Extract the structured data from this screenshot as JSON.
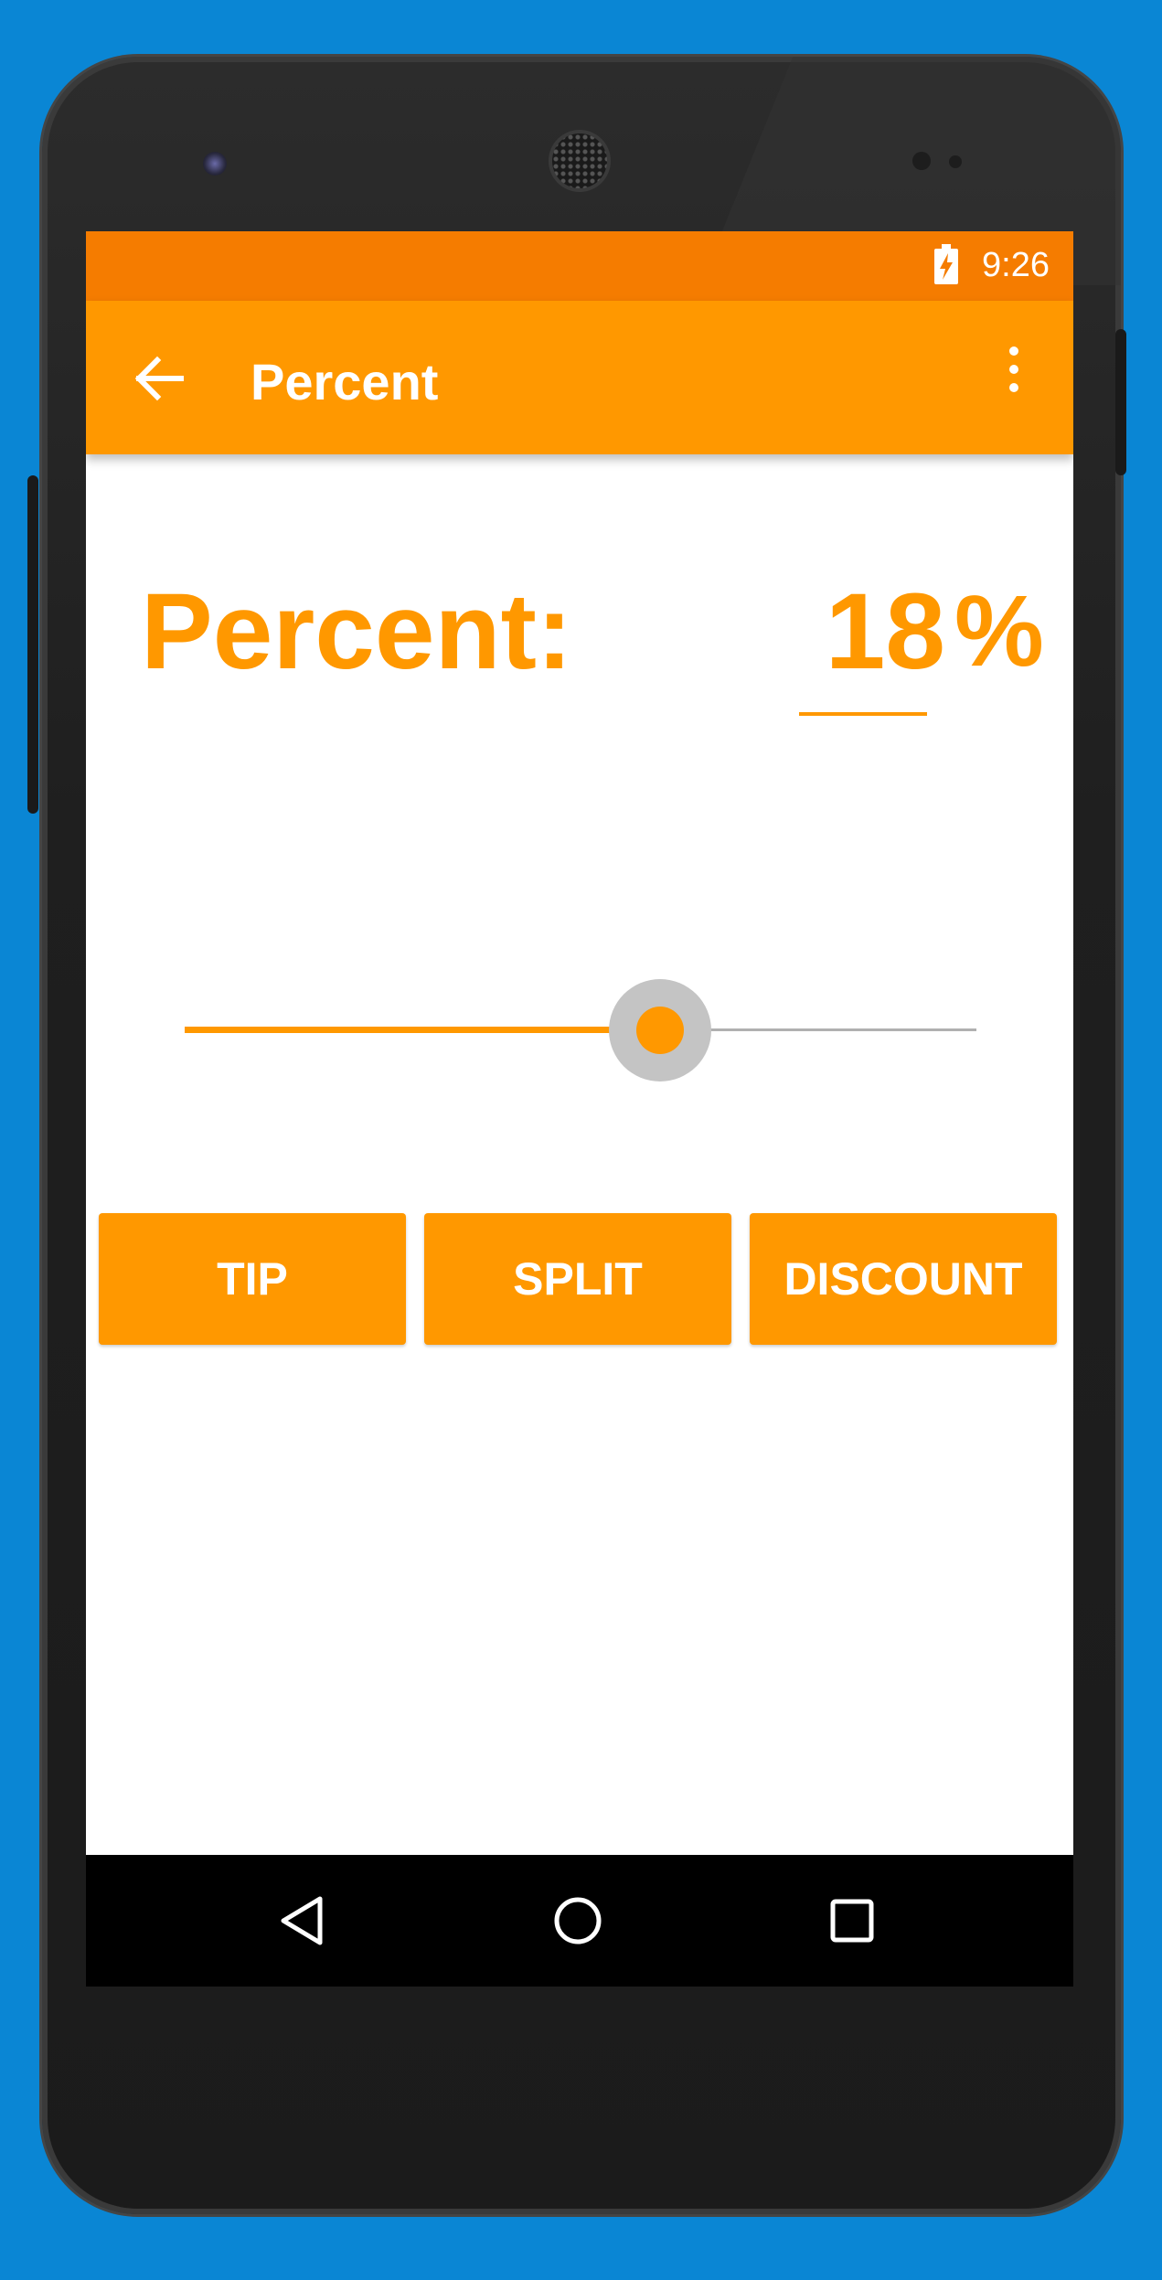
{
  "status_bar": {
    "time": "9:26"
  },
  "app_bar": {
    "title": "Percent"
  },
  "main": {
    "percent_label": "Percent:",
    "percent_value": "18",
    "percent_unit": "%",
    "slider_fraction": 0.6
  },
  "buttons": {
    "tip": "TIP",
    "split": "SPLIT",
    "discount": "DISCOUNT"
  },
  "colors": {
    "accent": "#ff9800",
    "status_bar": "#f57c00",
    "background": "#0a86d4",
    "slider_track": "#b0b0b0"
  },
  "icons": {
    "back": "arrow-back-icon",
    "overflow": "more-vertical-icon",
    "battery": "battery-charging-icon",
    "nav_back": "triangle-back-icon",
    "nav_home": "circle-home-icon",
    "nav_recents": "square-recents-icon"
  }
}
